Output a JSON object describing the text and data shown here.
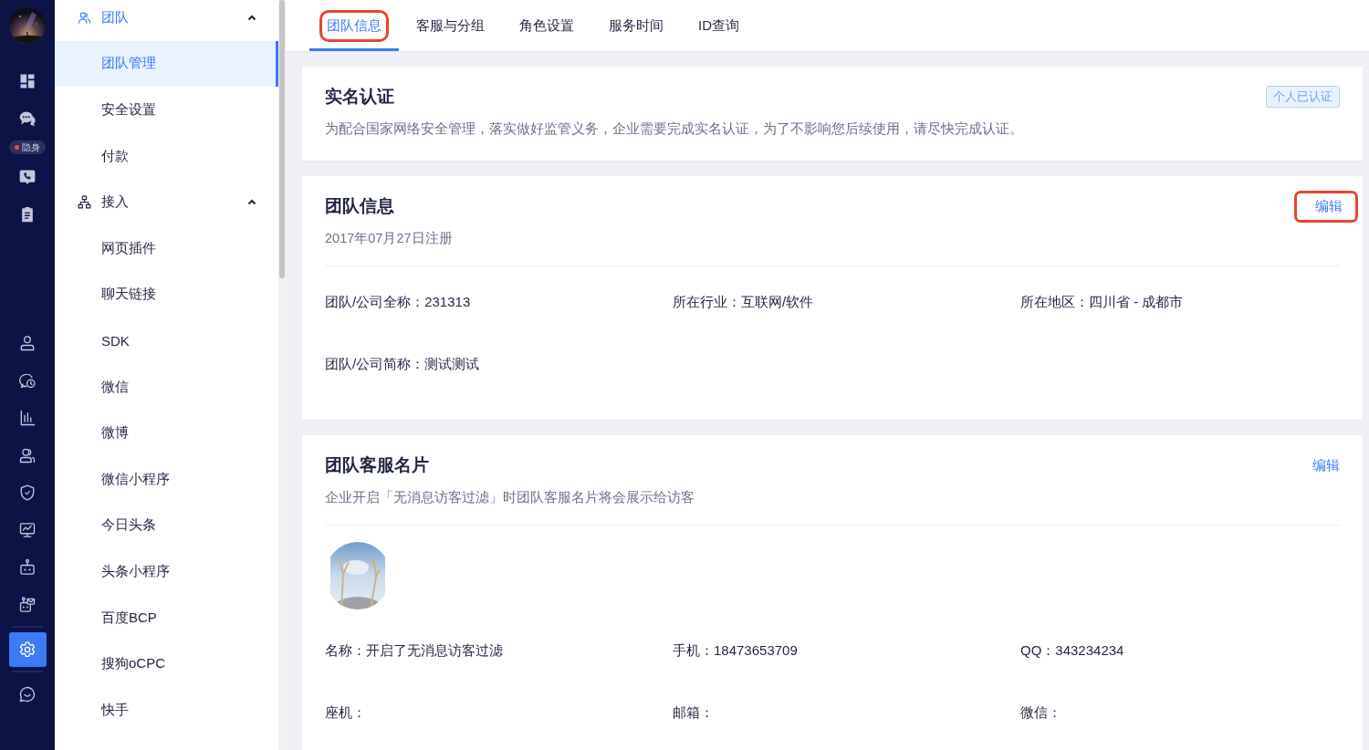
{
  "rail": {
    "status_badge": "隐身",
    "items": [
      {
        "kind": "grid",
        "selected": false
      },
      {
        "kind": "chat",
        "selected": false
      },
      {
        "kind": "phone",
        "selected": false
      },
      {
        "kind": "clipboard",
        "selected": false
      },
      {
        "kind": "user",
        "selected": false
      },
      {
        "kind": "history",
        "selected": false
      },
      {
        "kind": "chart",
        "selected": false
      },
      {
        "kind": "users",
        "selected": false
      },
      {
        "kind": "shield",
        "selected": false
      },
      {
        "kind": "monitor",
        "selected": false
      },
      {
        "kind": "robot",
        "selected": false
      },
      {
        "kind": "robot-mail",
        "selected": false
      },
      {
        "kind": "settings",
        "selected": true
      },
      {
        "kind": "smile",
        "selected": false
      }
    ]
  },
  "menu": [
    {
      "label": "团队",
      "kind": "team",
      "expanded": true,
      "items": [
        {
          "label": "团队管理",
          "selected": true
        },
        {
          "label": "安全设置",
          "selected": false
        },
        {
          "label": "付款",
          "selected": false
        }
      ]
    },
    {
      "label": "接入",
      "kind": "network",
      "expanded": true,
      "items": [
        {
          "label": "网页插件",
          "selected": false
        },
        {
          "label": "聊天链接",
          "selected": false
        },
        {
          "label": "SDK",
          "selected": false
        },
        {
          "label": "微信",
          "selected": false
        },
        {
          "label": "微博",
          "selected": false
        },
        {
          "label": "微信小程序",
          "selected": false
        },
        {
          "label": "今日头条",
          "selected": false
        },
        {
          "label": "头条小程序",
          "selected": false
        },
        {
          "label": "百度BCP",
          "selected": false
        },
        {
          "label": "搜狗oCPC",
          "selected": false
        },
        {
          "label": "快手",
          "selected": false
        }
      ]
    }
  ],
  "tabs": [
    {
      "label": "团队信息",
      "selected": true,
      "annotated": true
    },
    {
      "label": "客服与分组",
      "selected": false,
      "annotated": false
    },
    {
      "label": "角色设置",
      "selected": false,
      "annotated": false
    },
    {
      "label": "服务时间",
      "selected": false,
      "annotated": false
    },
    {
      "label": "ID查询",
      "selected": false,
      "annotated": false
    }
  ],
  "cards": [
    {
      "title": "实名认证",
      "description": "为配合国家网络安全管理，落实做好监管义务，企业需要完成实名认证，为了不影响您后续使用，请尽快完成认证。",
      "badge": "个人已认证"
    },
    {
      "title": "团队信息",
      "description": "2017年07月27日注册",
      "edit_button": {
        "label": "编辑",
        "annotated": true
      },
      "fields": [
        "团队/公司全称：231313",
        "所在行业：互联网/软件",
        "所在地区：四川省 - 成都市",
        "团队/公司简称：测试测试"
      ]
    },
    {
      "title": "团队客服名片",
      "description": "企业开启「无消息访客过滤」时团队客服名片将会展示给访客",
      "edit_button": {
        "label": "编辑",
        "annotated": false
      },
      "fields": [
        "名称：开启了无消息访客过滤",
        "手机：18473653709",
        "QQ：343234234",
        "座机：",
        "邮箱：",
        "微信："
      ]
    }
  ]
}
